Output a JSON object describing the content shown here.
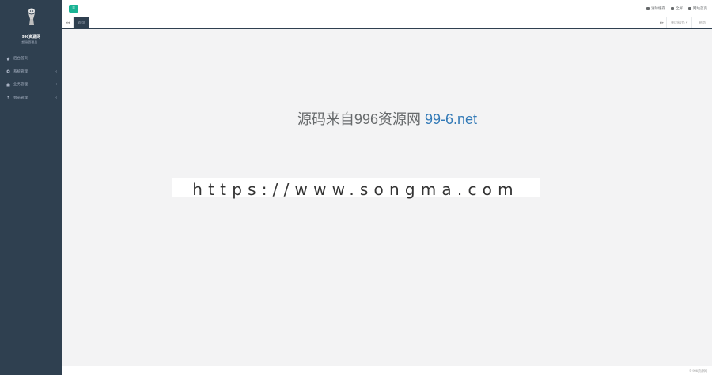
{
  "sidebar": {
    "site_name": "996资源网",
    "site_sub": "超级管理员 ⌄",
    "items": [
      {
        "label": "后台首页",
        "icon": "home-icon",
        "has_arrow": false
      },
      {
        "label": "系统管理",
        "icon": "gear-icon",
        "has_arrow": true
      },
      {
        "label": "业务管理",
        "icon": "briefcase-icon",
        "has_arrow": true
      },
      {
        "label": "会员管理",
        "icon": "user-icon",
        "has_arrow": true
      }
    ]
  },
  "topbar": {
    "toggle_label": "≡",
    "links": [
      {
        "label": "清除缓存",
        "icon": "trash-icon"
      },
      {
        "label": "全屏",
        "icon": "fullscreen-icon"
      },
      {
        "label": "网站首页",
        "icon": "globe-icon"
      }
    ]
  },
  "tabs": {
    "left_nav": "◂◂",
    "active_tab": "首页",
    "right_nav": "▸▸",
    "close_menu": "关闭操作 ▾",
    "refresh": "刷新"
  },
  "content": {
    "title_main": "源码来自996资源网 ",
    "title_link": "99-6.net",
    "url": "https://www.songma.com"
  },
  "footer": {
    "copyright": "© 996资源网"
  },
  "colors": {
    "sidebar_bg": "#2f4050",
    "accent": "#1ab394",
    "link_blue": "#337ab7"
  }
}
